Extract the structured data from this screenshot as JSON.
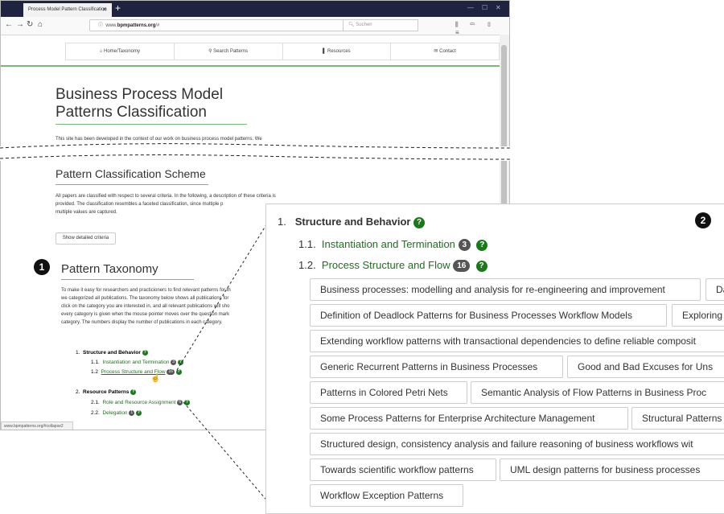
{
  "browser": {
    "tab_title": "Process Model Pattern Classification",
    "tab_close": "✕",
    "new_tab": "+",
    "win_min": "—",
    "win_max": "☐",
    "win_close": "✕",
    "url_prefix": "www.",
    "url_domain": "bpmpatterns.org",
    "url_suffix": "/#",
    "url_icons": "··· ⛉ ☆",
    "search_placeholder": "Suchen",
    "status_url": "www.bpmpatterns.org/#collapse2"
  },
  "site_nav": {
    "home": "Home/Taxonomy",
    "search": "Search Patterns",
    "resources": "Resources",
    "contact": "Contact"
  },
  "page": {
    "title_line1": "Business Process Model",
    "title_line2": "Patterns Classification",
    "intro": "This site has been developed in the context of our work on business process model patterns. We",
    "scheme_heading": "Pattern Classification Scheme",
    "scheme_text_1": "All papers are classified with respect to several criteria. In the following, a description of these criteria is",
    "scheme_text_2": "provided. The classification resembles a faceted classification, since multiple p",
    "scheme_text_3": "multiple values are captured.",
    "show_criteria": "Show detailed criteria",
    "taxonomy_heading": "Pattern Taxonomy",
    "tax_text_1": "To make it easy for researchers and practicioners to find relevant patterns for th",
    "tax_text_2": "we categorized all publications. The taxonomy below shows all publications for",
    "tax_text_3": "click on the category you are interested in, and all relevant publications will sho",
    "tax_text_4": "every category is given when the mouse pointer moves over the question mark",
    "tax_text_5": "category. The numbers display the number of publications in each category."
  },
  "taxonomy": {
    "c1_num": "1.",
    "c1_label": "Structure and Behavior",
    "c11_num": "1.1.",
    "c11_label": "Instantiation and Termination",
    "c11_count": "3",
    "c12_num": "1.2",
    "c12_label": "Process Structure and Flow",
    "c12_count": "16",
    "c2_num": "2.",
    "c2_label": "Resource Patterns",
    "c21_num": "2.1.",
    "c21_label": "Role and Resource Assignment",
    "c21_count": "6",
    "c22_num": "2.2.",
    "c22_label": "Delegation",
    "c22_count": "1"
  },
  "zoom": {
    "c1_num": "1.",
    "c1_label": "Structure and Behavior",
    "c11_num": "1.1.",
    "c11_label": "Instantiation and Termination",
    "c11_count": "3",
    "c12_num": "1.2.",
    "c12_label": "Process Structure and Flow",
    "c12_count": "16",
    "publications": [
      "Business processes: modelling and analysis for re-engineering and improvement",
      "Da",
      "Definition of Deadlock Patterns for Business Processes Workflow Models",
      "Exploring",
      "Extending workflow patterns with transactional dependencies to define reliable composit",
      "Generic Recurrent Patterns in Business Processes",
      "Good and Bad Excuses for Uns",
      "Patterns in Colored Petri Nets",
      "Semantic Analysis of Flow Patterns in Business Proc",
      "Some Process Patterns for Enterprise Architecture Management",
      "Structural Patterns",
      "Structured design, consistency analysis and failure reasoning of business workflows wit",
      "Towards scientific workflow patterns",
      "UML design patterns for business processes",
      "Workflow Exception Patterns"
    ]
  },
  "markers": {
    "m1": "1",
    "m2": "2"
  },
  "icons": {
    "qm": "?",
    "home": "home-icon",
    "search": "search-icon",
    "resources": "bookmark-icon",
    "contact": "mail-icon"
  },
  "colors": {
    "accent_green": "#1f6f1f",
    "tabbar": "#202340",
    "badge": "#555555"
  }
}
